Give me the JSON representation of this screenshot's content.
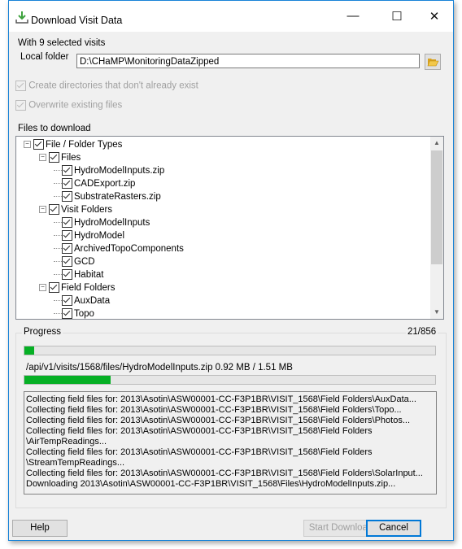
{
  "window": {
    "title": "Download Visit Data",
    "controls": [
      "minimize",
      "maximize",
      "close"
    ]
  },
  "selection_text": "With 9 selected visits",
  "local_folder": {
    "label": "Local folder",
    "value": "D:\\CHaMP\\MonitoringDataZipped",
    "browse_icon": "folder-open-icon"
  },
  "options": [
    {
      "label": "Create directories that don't already exist",
      "checked": true,
      "enabled": false
    },
    {
      "label": "Overwrite existing files",
      "checked": true,
      "enabled": false
    }
  ],
  "files_label": "Files to download",
  "tree": [
    {
      "label": "File / Folder Types",
      "level": 0,
      "expander": "minus",
      "checked": true
    },
    {
      "label": "Files",
      "level": 1,
      "expander": "minus",
      "checked": true
    },
    {
      "label": "HydroModelInputs.zip",
      "level": 2,
      "checked": true
    },
    {
      "label": "CADExport.zip",
      "level": 2,
      "checked": true
    },
    {
      "label": "SubstrateRasters.zip",
      "level": 2,
      "checked": true
    },
    {
      "label": "Visit Folders",
      "level": 1,
      "expander": "minus",
      "checked": true
    },
    {
      "label": "HydroModelInputs",
      "level": 2,
      "checked": true
    },
    {
      "label": "HydroModel",
      "level": 2,
      "checked": true
    },
    {
      "label": "ArchivedTopoComponents",
      "level": 2,
      "checked": true
    },
    {
      "label": "GCD",
      "level": 2,
      "checked": true
    },
    {
      "label": "Habitat",
      "level": 2,
      "checked": true
    },
    {
      "label": "Field Folders",
      "level": 1,
      "expander": "minus",
      "checked": true
    },
    {
      "label": "AuxData",
      "level": 2,
      "checked": true
    },
    {
      "label": "Topo",
      "level": 2,
      "checked": true
    }
  ],
  "progress": {
    "label": "Progress",
    "count": "21/856",
    "overall_done": 21,
    "overall_total": 856,
    "current_file": "/api/v1/visits/1568/files/HydroModelInputs.zip 0.92 MB / 1.51 MB",
    "file_progress_percent": 21,
    "color": "#06b025"
  },
  "log": [
    "Collecting field files for: 2013\\Asotin\\ASW00001-CC-F3P1BR\\VISIT_1568\\Field Folders\\AuxData...",
    "Collecting field files for: 2013\\Asotin\\ASW00001-CC-F3P1BR\\VISIT_1568\\Field Folders\\Topo...",
    "Collecting field files for: 2013\\Asotin\\ASW00001-CC-F3P1BR\\VISIT_1568\\Field Folders\\Photos...",
    "Collecting field files for: 2013\\Asotin\\ASW00001-CC-F3P1BR\\VISIT_1568\\Field Folders\n\\AirTempReadings...",
    "Collecting field files for: 2013\\Asotin\\ASW00001-CC-F3P1BR\\VISIT_1568\\Field Folders\n\\StreamTempReadings...",
    "Collecting field files for: 2013\\Asotin\\ASW00001-CC-F3P1BR\\VISIT_1568\\Field Folders\\SolarInput...",
    "Downloading 2013\\Asotin\\ASW00001-CC-F3P1BR\\VISIT_1568\\Files\\HydroModelInputs.zip..."
  ],
  "buttons": {
    "help": "Help",
    "start": "Start Download",
    "cancel": "Cancel"
  }
}
